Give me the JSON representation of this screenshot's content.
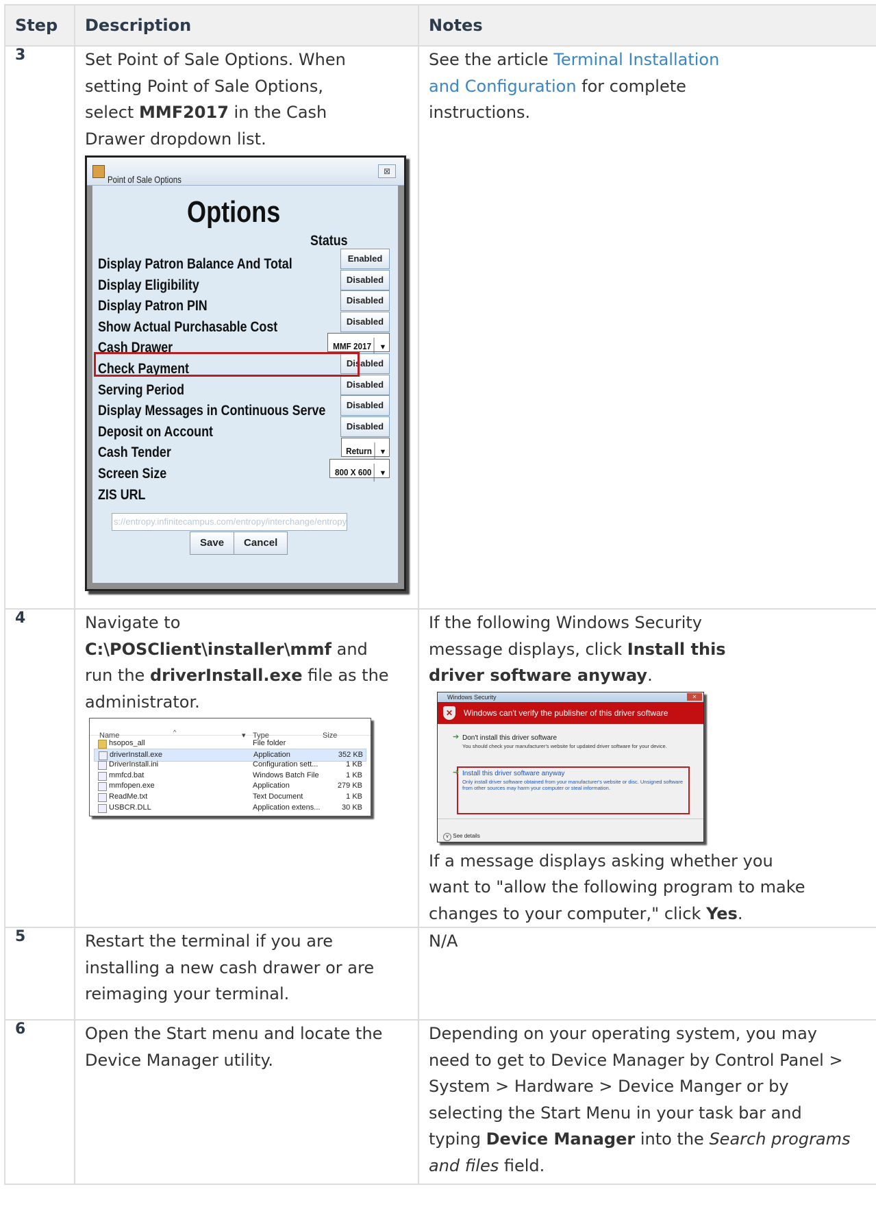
{
  "headers": [
    "Step",
    "Description",
    "Notes"
  ],
  "rows": [
    {
      "step": "3",
      "desc": [
        "Set Point of Sale Options. When setting Point of Sale Options, select ",
        "MMF2017",
        " in the Cash Drawer dropdown list."
      ],
      "notes": [
        "See the article ",
        "Terminal Installation and Configuration",
        " for complete instructions."
      ]
    },
    {
      "step": "4",
      "desc": [
        "Navigate to ",
        "C:\\POSClient\\installer\\mmf",
        " and run the ",
        "driverInstall.exe",
        " file as the administrator."
      ],
      "notes": [
        "If the following Windows Security message displays, click ",
        "Install this driver software anyway",
        "."
      ],
      "notes2": [
        "If a message displays asking whether you want to \"allow the following program to make changes to your computer,\" click ",
        "Yes",
        "."
      ]
    },
    {
      "step": "5",
      "desc": [
        "Restart the terminal if you are installing a new cash drawer or are reimaging your terminal."
      ],
      "notes": [
        "N/A"
      ]
    },
    {
      "step": "6",
      "desc": [
        "Open the Start menu and locate the Device Manager utility."
      ],
      "notes": [
        "Depending on your operating system, you may need to get to Device Manager by Control Panel > System > Hardware > Device Manger or by selecting the Start Menu in your task bar and typing ",
        "Device Manager",
        " into the ",
        "Search programs and files",
        " field."
      ]
    }
  ],
  "pos_dialog": {
    "title": "Point of Sale Options",
    "close": "⊠",
    "heading": "Options",
    "status_header": "Status",
    "rows": [
      {
        "label": "Display Patron Balance And Total",
        "value": "Enabled",
        "kind": "button"
      },
      {
        "label": "Display Eligibility",
        "value": "Disabled",
        "kind": "button"
      },
      {
        "label": "Display Patron PIN",
        "value": "Disabled",
        "kind": "button"
      },
      {
        "label": "Show Actual Purchasable Cost",
        "value": "Disabled",
        "kind": "button"
      },
      {
        "label": "Cash Drawer",
        "value": "MMF 2017",
        "kind": "select"
      },
      {
        "label": "Check Payment",
        "value": "Disabled",
        "kind": "button"
      },
      {
        "label": "Serving Period",
        "value": "Disabled",
        "kind": "button"
      },
      {
        "label": "Display Messages in Continuous Serve",
        "value": "Disabled",
        "kind": "button"
      },
      {
        "label": "Deposit on Account",
        "value": "Disabled",
        "kind": "button"
      },
      {
        "label": "Cash Tender",
        "value": "Return",
        "kind": "select"
      },
      {
        "label": "Screen Size",
        "value": "800 X 600",
        "kind": "select"
      },
      {
        "label": "ZIS URL",
        "value": "",
        "kind": "none"
      }
    ],
    "url_value": "s://entropy.infinitecampus.com/entropy/interchange/entropyMaster/POS",
    "save": "Save",
    "cancel": "Cancel"
  },
  "explorer": {
    "columns": [
      "Name",
      "Type",
      "Size"
    ],
    "files": [
      {
        "name": "hsopos_all",
        "type": "File folder",
        "size": "",
        "icon": "folder-icon"
      },
      {
        "name": "driverInstall.exe",
        "type": "Application",
        "size": "352 KB",
        "icon": "exe-icon"
      },
      {
        "name": "DriverInstall.ini",
        "type": "Configuration sett...",
        "size": "1 KB",
        "icon": "settings-file-icon"
      },
      {
        "name": "mmfcd.bat",
        "type": "Windows Batch File",
        "size": "1 KB",
        "icon": "batch-file-icon"
      },
      {
        "name": "mmfopen.exe",
        "type": "Application",
        "size": "279 KB",
        "icon": "exe-icon"
      },
      {
        "name": "ReadMe.txt",
        "type": "Text Document",
        "size": "1 KB",
        "icon": "text-file-icon"
      },
      {
        "name": "USBCR.DLL",
        "type": "Application extens...",
        "size": "30 KB",
        "icon": "dll-file-icon"
      }
    ]
  },
  "win_security": {
    "title": "Windows Security",
    "banner": "Windows can't verify the publisher of this driver software",
    "opt1_title": "Don't install this driver software",
    "opt1_desc": "You should check your manufacturer's website for updated driver software for your device.",
    "opt2_title": "Install this driver software anyway",
    "opt2_desc": "Only install driver software obtained from your manufacturer's website or disc. Unsigned software from other sources may harm your computer or steal information.",
    "details": "See details"
  }
}
